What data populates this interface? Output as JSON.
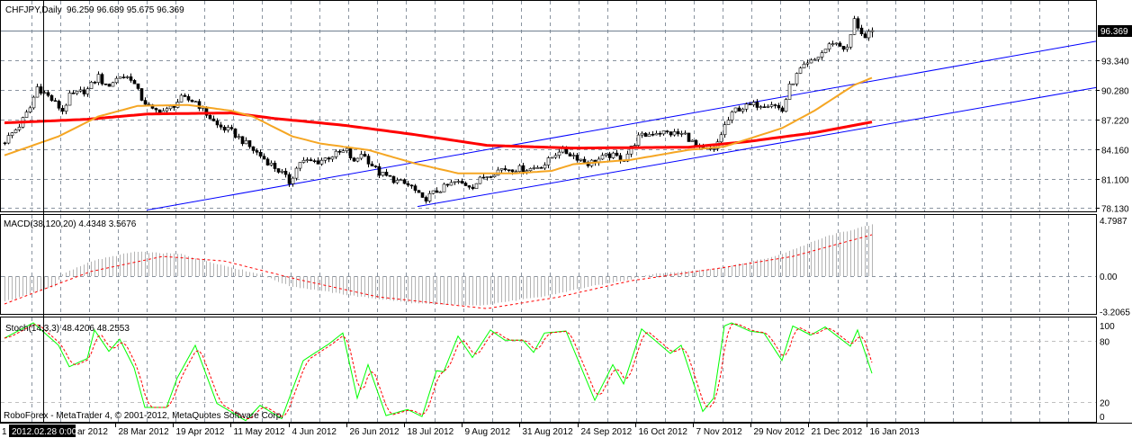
{
  "header": {
    "symbol_label": "CHFJPY,Daily",
    "ohlc": "96.259 96.689 95.675 96.369"
  },
  "macd_label": "MACD(38,120,20) 4.4348 3.5676",
  "stoch_label": "Stoch(14,3,3) 48.4206 48.2553",
  "watermark": "RoboForex - MetaTrader 4, © 2001-2012, MetaQuotes Software Corp.",
  "crosshair_time": "2012.02.28 0:00",
  "colors": {
    "ma_fast": "#f5a623",
    "ma_slow": "#ff0000",
    "trendline": "#0000ff",
    "macd_hist": "#b4b4b4",
    "macd_signal": "#ff0000",
    "stoch_main": "#00ff00",
    "stoch_signal": "#ff0000",
    "current_price_line": "#708090"
  },
  "chart_data": [
    {
      "type": "candlestick",
      "title": "CHFJPY,Daily",
      "last_bar": {
        "open": 96.259,
        "high": 96.689,
        "low": 95.675,
        "close": 96.369
      },
      "current_price": "96.369",
      "y_ticks": [
        "93.340",
        "90.280",
        "87.220",
        "84.160",
        "81.100",
        "78.130"
      ],
      "ylim": [
        78.13,
        96.369
      ],
      "x_first_label": "1",
      "x_partial_label": "ar 2012",
      "x_labels": [
        "28 Mar 2012",
        "19 Apr 2012",
        "11 May 2012",
        "4 Jun 2012",
        "26 Jun 2012",
        "18 Jul 2012",
        "9 Aug 2012",
        "31 Aug 2012",
        "24 Sep 2012",
        "16 Oct 2012",
        "7 Nov 2012",
        "29 Nov 2012",
        "21 Dec 2012",
        "16 Jan 2013"
      ],
      "bar_count": 242,
      "close_keypoints": [
        [
          0,
          84.99
        ],
        [
          4,
          86.57
        ],
        [
          7,
          88.4
        ],
        [
          9,
          90.56
        ],
        [
          12,
          89.6
        ],
        [
          16,
          88.1
        ],
        [
          18,
          89.6
        ],
        [
          23,
          90.28
        ],
        [
          26,
          91.67
        ],
        [
          28,
          90.56
        ],
        [
          32,
          91.67
        ],
        [
          35,
          91.5
        ],
        [
          38,
          89.35
        ],
        [
          41,
          88.1
        ],
        [
          45,
          88.1
        ],
        [
          49,
          89.35
        ],
        [
          53,
          89.07
        ],
        [
          56,
          87.77
        ],
        [
          59,
          86.57
        ],
        [
          63,
          85.92
        ],
        [
          66,
          84.99
        ],
        [
          69,
          84.06
        ],
        [
          72,
          83.14
        ],
        [
          77,
          81.65
        ],
        [
          79,
          80.72
        ],
        [
          82,
          82.86
        ],
        [
          87,
          82.86
        ],
        [
          91,
          83.5
        ],
        [
          95,
          83.97
        ],
        [
          97,
          82.67
        ],
        [
          99,
          83.78
        ],
        [
          104,
          81.65
        ],
        [
          109,
          80.82
        ],
        [
          113,
          80.26
        ],
        [
          116,
          78.87
        ],
        [
          120,
          79.8
        ],
        [
          125,
          80.72
        ],
        [
          130,
          80.36
        ],
        [
          133,
          81.28
        ],
        [
          138,
          82.12
        ],
        [
          146,
          82.12
        ],
        [
          150,
          82.58
        ],
        [
          154,
          84.06
        ],
        [
          158,
          83.5
        ],
        [
          162,
          82.67
        ],
        [
          168,
          83.5
        ],
        [
          172,
          83.14
        ],
        [
          176,
          85.36
        ],
        [
          181,
          85.92
        ],
        [
          189,
          85.64
        ],
        [
          193,
          84.06
        ],
        [
          197,
          83.97
        ],
        [
          200,
          86.57
        ],
        [
          203,
          88.24
        ],
        [
          208,
          88.7
        ],
        [
          213,
          88.89
        ],
        [
          216,
          88.1
        ],
        [
          218,
          90.56
        ],
        [
          221,
          92.32
        ],
        [
          225,
          93.34
        ],
        [
          230,
          95.2
        ],
        [
          234,
          94.45
        ],
        [
          236,
          97.42
        ],
        [
          239,
          95.57
        ],
        [
          241,
          96.369
        ]
      ],
      "ma_fast_keypoints": [
        [
          0,
          83.5
        ],
        [
          15,
          85.45
        ],
        [
          26,
          87.5
        ],
        [
          37,
          88.6
        ],
        [
          51,
          88.7
        ],
        [
          63,
          88.1
        ],
        [
          69,
          87.5
        ],
        [
          80,
          85.45
        ],
        [
          88,
          84.7
        ],
        [
          101,
          84.06
        ],
        [
          114,
          82.67
        ],
        [
          126,
          81.65
        ],
        [
          142,
          81.65
        ],
        [
          152,
          81.9
        ],
        [
          158,
          82.58
        ],
        [
          174,
          83.04
        ],
        [
          190,
          84.06
        ],
        [
          200,
          84.4
        ],
        [
          216,
          86.3
        ],
        [
          225,
          88.1
        ],
        [
          236,
          90.74
        ],
        [
          241,
          91.5
        ]
      ],
      "ma_slow_keypoints": [
        [
          0,
          86.85
        ],
        [
          23,
          87.22
        ],
        [
          40,
          87.77
        ],
        [
          63,
          87.87
        ],
        [
          75,
          87.31
        ],
        [
          95,
          86.57
        ],
        [
          114,
          85.64
        ],
        [
          134,
          84.53
        ],
        [
          158,
          84.25
        ],
        [
          190,
          84.34
        ],
        [
          206,
          84.9
        ],
        [
          225,
          85.83
        ],
        [
          241,
          86.94
        ]
      ],
      "trendlines": [
        {
          "name": "upper-channel",
          "points": [
            [
              39.5,
              77.85
            ],
            [
              248.75,
              91.67
            ]
          ]
        },
        {
          "name": "lower-channel",
          "points": [
            [
              114.75,
              78.22
            ],
            [
              248.75,
              86.94
            ]
          ]
        }
      ]
    },
    {
      "type": "bar",
      "title": "MACD(38,120,20)",
      "y_ticks": [
        "4.7987",
        "0.00",
        "-3.2065"
      ],
      "ylim": [
        -3.2065,
        4.7987
      ],
      "hist_keypoints": [
        [
          0,
          -2.2
        ],
        [
          14,
          -0.85
        ],
        [
          16,
          0.15
        ],
        [
          24,
          1.3
        ],
        [
          36,
          2.1
        ],
        [
          49,
          1.9
        ],
        [
          61,
          0.9
        ],
        [
          71,
          0.15
        ],
        [
          79,
          -0.85
        ],
        [
          99,
          -1.8
        ],
        [
          116,
          -2.4
        ],
        [
          131,
          -2.55
        ],
        [
          149,
          -1.8
        ],
        [
          161,
          -1.0
        ],
        [
          174,
          -0.25
        ],
        [
          179,
          0.15
        ],
        [
          199,
          0.7
        ],
        [
          214,
          1.7
        ],
        [
          229,
          3.5
        ],
        [
          241,
          4.4348
        ]
      ],
      "signal_keypoints": [
        [
          0,
          -2.4
        ],
        [
          24,
          0.4
        ],
        [
          44,
          1.7
        ],
        [
          61,
          1.3
        ],
        [
          81,
          -0.25
        ],
        [
          104,
          -1.8
        ],
        [
          134,
          -2.8
        ],
        [
          154,
          -1.8
        ],
        [
          174,
          -0.4
        ],
        [
          199,
          0.7
        ],
        [
          219,
          1.7
        ],
        [
          241,
          3.5676
        ]
      ]
    },
    {
      "type": "line",
      "title": "Stoch(14,3,3)",
      "y_ticks": [
        "100",
        "80",
        "20",
        "0"
      ],
      "ylim": [
        0,
        100
      ],
      "main_keypoints": [
        [
          0,
          83
        ],
        [
          8,
          98
        ],
        [
          15,
          76
        ],
        [
          18,
          55
        ],
        [
          23,
          63
        ],
        [
          25,
          91
        ],
        [
          29,
          70
        ],
        [
          32,
          82
        ],
        [
          36,
          54
        ],
        [
          39,
          15
        ],
        [
          45,
          15
        ],
        [
          48,
          44
        ],
        [
          53,
          76
        ],
        [
          59,
          19
        ],
        [
          67,
          2
        ],
        [
          71,
          17
        ],
        [
          77,
          4
        ],
        [
          83,
          61
        ],
        [
          90,
          77
        ],
        [
          94,
          88
        ],
        [
          98,
          24
        ],
        [
          101,
          57
        ],
        [
          106,
          7
        ],
        [
          112,
          13
        ],
        [
          116,
          6
        ],
        [
          120,
          51
        ],
        [
          122,
          50
        ],
        [
          126,
          85
        ],
        [
          130,
          64
        ],
        [
          135,
          91
        ],
        [
          139,
          81
        ],
        [
          144,
          81
        ],
        [
          147,
          69
        ],
        [
          150,
          88
        ],
        [
          156,
          90
        ],
        [
          164,
          22
        ],
        [
          169,
          57
        ],
        [
          172,
          38
        ],
        [
          177,
          92
        ],
        [
          185,
          68
        ],
        [
          188,
          76
        ],
        [
          194,
          11
        ],
        [
          197,
          24
        ],
        [
          200,
          95
        ],
        [
          202,
          98
        ],
        [
          207,
          90
        ],
        [
          211,
          88
        ],
        [
          216,
          61
        ],
        [
          219,
          95
        ],
        [
          224,
          86
        ],
        [
          228,
          94
        ],
        [
          235,
          75
        ],
        [
          237,
          91
        ],
        [
          241,
          48.4206
        ]
      ]
    }
  ]
}
